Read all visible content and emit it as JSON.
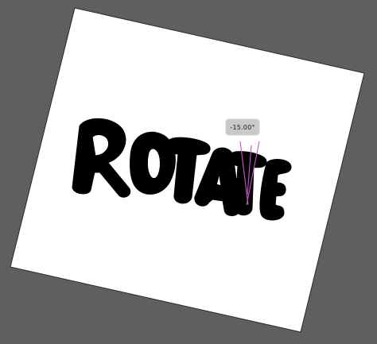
{
  "canvas": {
    "background_color": "#5f5f5f",
    "artboard_color": "#ffffff"
  },
  "artwork": {
    "word": "ROTATE",
    "fill_color": "#000000"
  },
  "rotation_guide": {
    "angle_label": "-15.00°",
    "guide_color": "#cc55cc"
  }
}
